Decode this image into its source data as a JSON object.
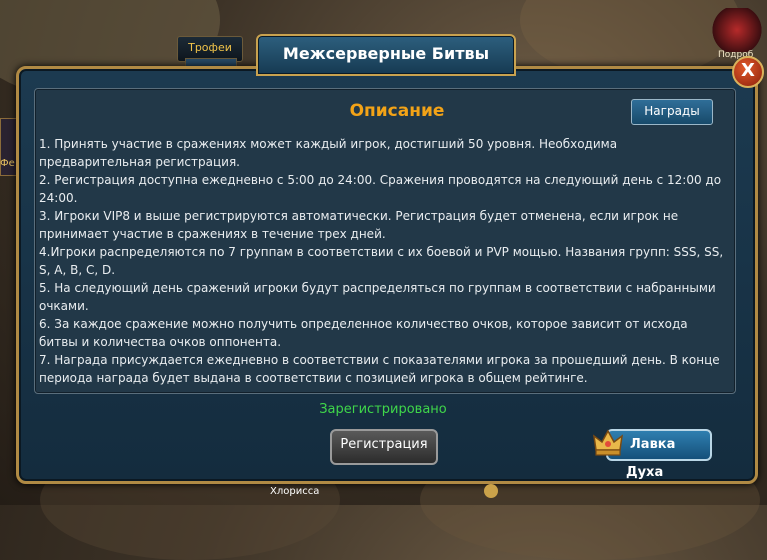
{
  "game_hud": {
    "trophies_tab": "Трофеи",
    "left_side_label": "Фе",
    "corner_label": "Подроб",
    "bottom_player_name": "Хлорисса"
  },
  "dialog": {
    "title": "Межсерверные Битвы",
    "close_label": "X",
    "panel": {
      "heading": "Описание",
      "rewards_button": "Награды",
      "rules": [
        "1. Принять участие в сражениях может каждый игрок, достигший 50 уровня. Необходима предварительная регистрация.",
        "2. Регистрация доступна ежедневно с 5:00 до 24:00. Сражения проводятся на следующий день с 12:00 до 24:00.",
        "3. Игроки VIP8 и выше регистрируются автоматически. Регистрация будет отменена, если игрок не принимает участие в сражениях в течение трех дней.",
        "4.Игроки распределяются по 7 группам в соответствии с их боевой и PVP мощью. Названия групп: SSS, SS, S, A, B, C, D.",
        "5. На следующий день сражений игроки будут распределяться по группам в соответствии с набранными очками.",
        "6. За каждое сражение можно получить определенное количество очков, которое зависит от исхода битвы и количества очков оппонента.",
        "7. Награда присуждается ежедневно в соответствии с показателями игрока за прошедший день. В конце периода награда будет выдана в соответствии с позицией игрока в общем рейтинге."
      ]
    },
    "status": "Зарегистрировано",
    "register_button": "Регистрация",
    "spirit_shop_button": "Лавка Духа"
  },
  "colors": {
    "accent_gold": "#c9a24f",
    "heading_orange": "#f3a317",
    "status_green": "#3fd64a"
  }
}
